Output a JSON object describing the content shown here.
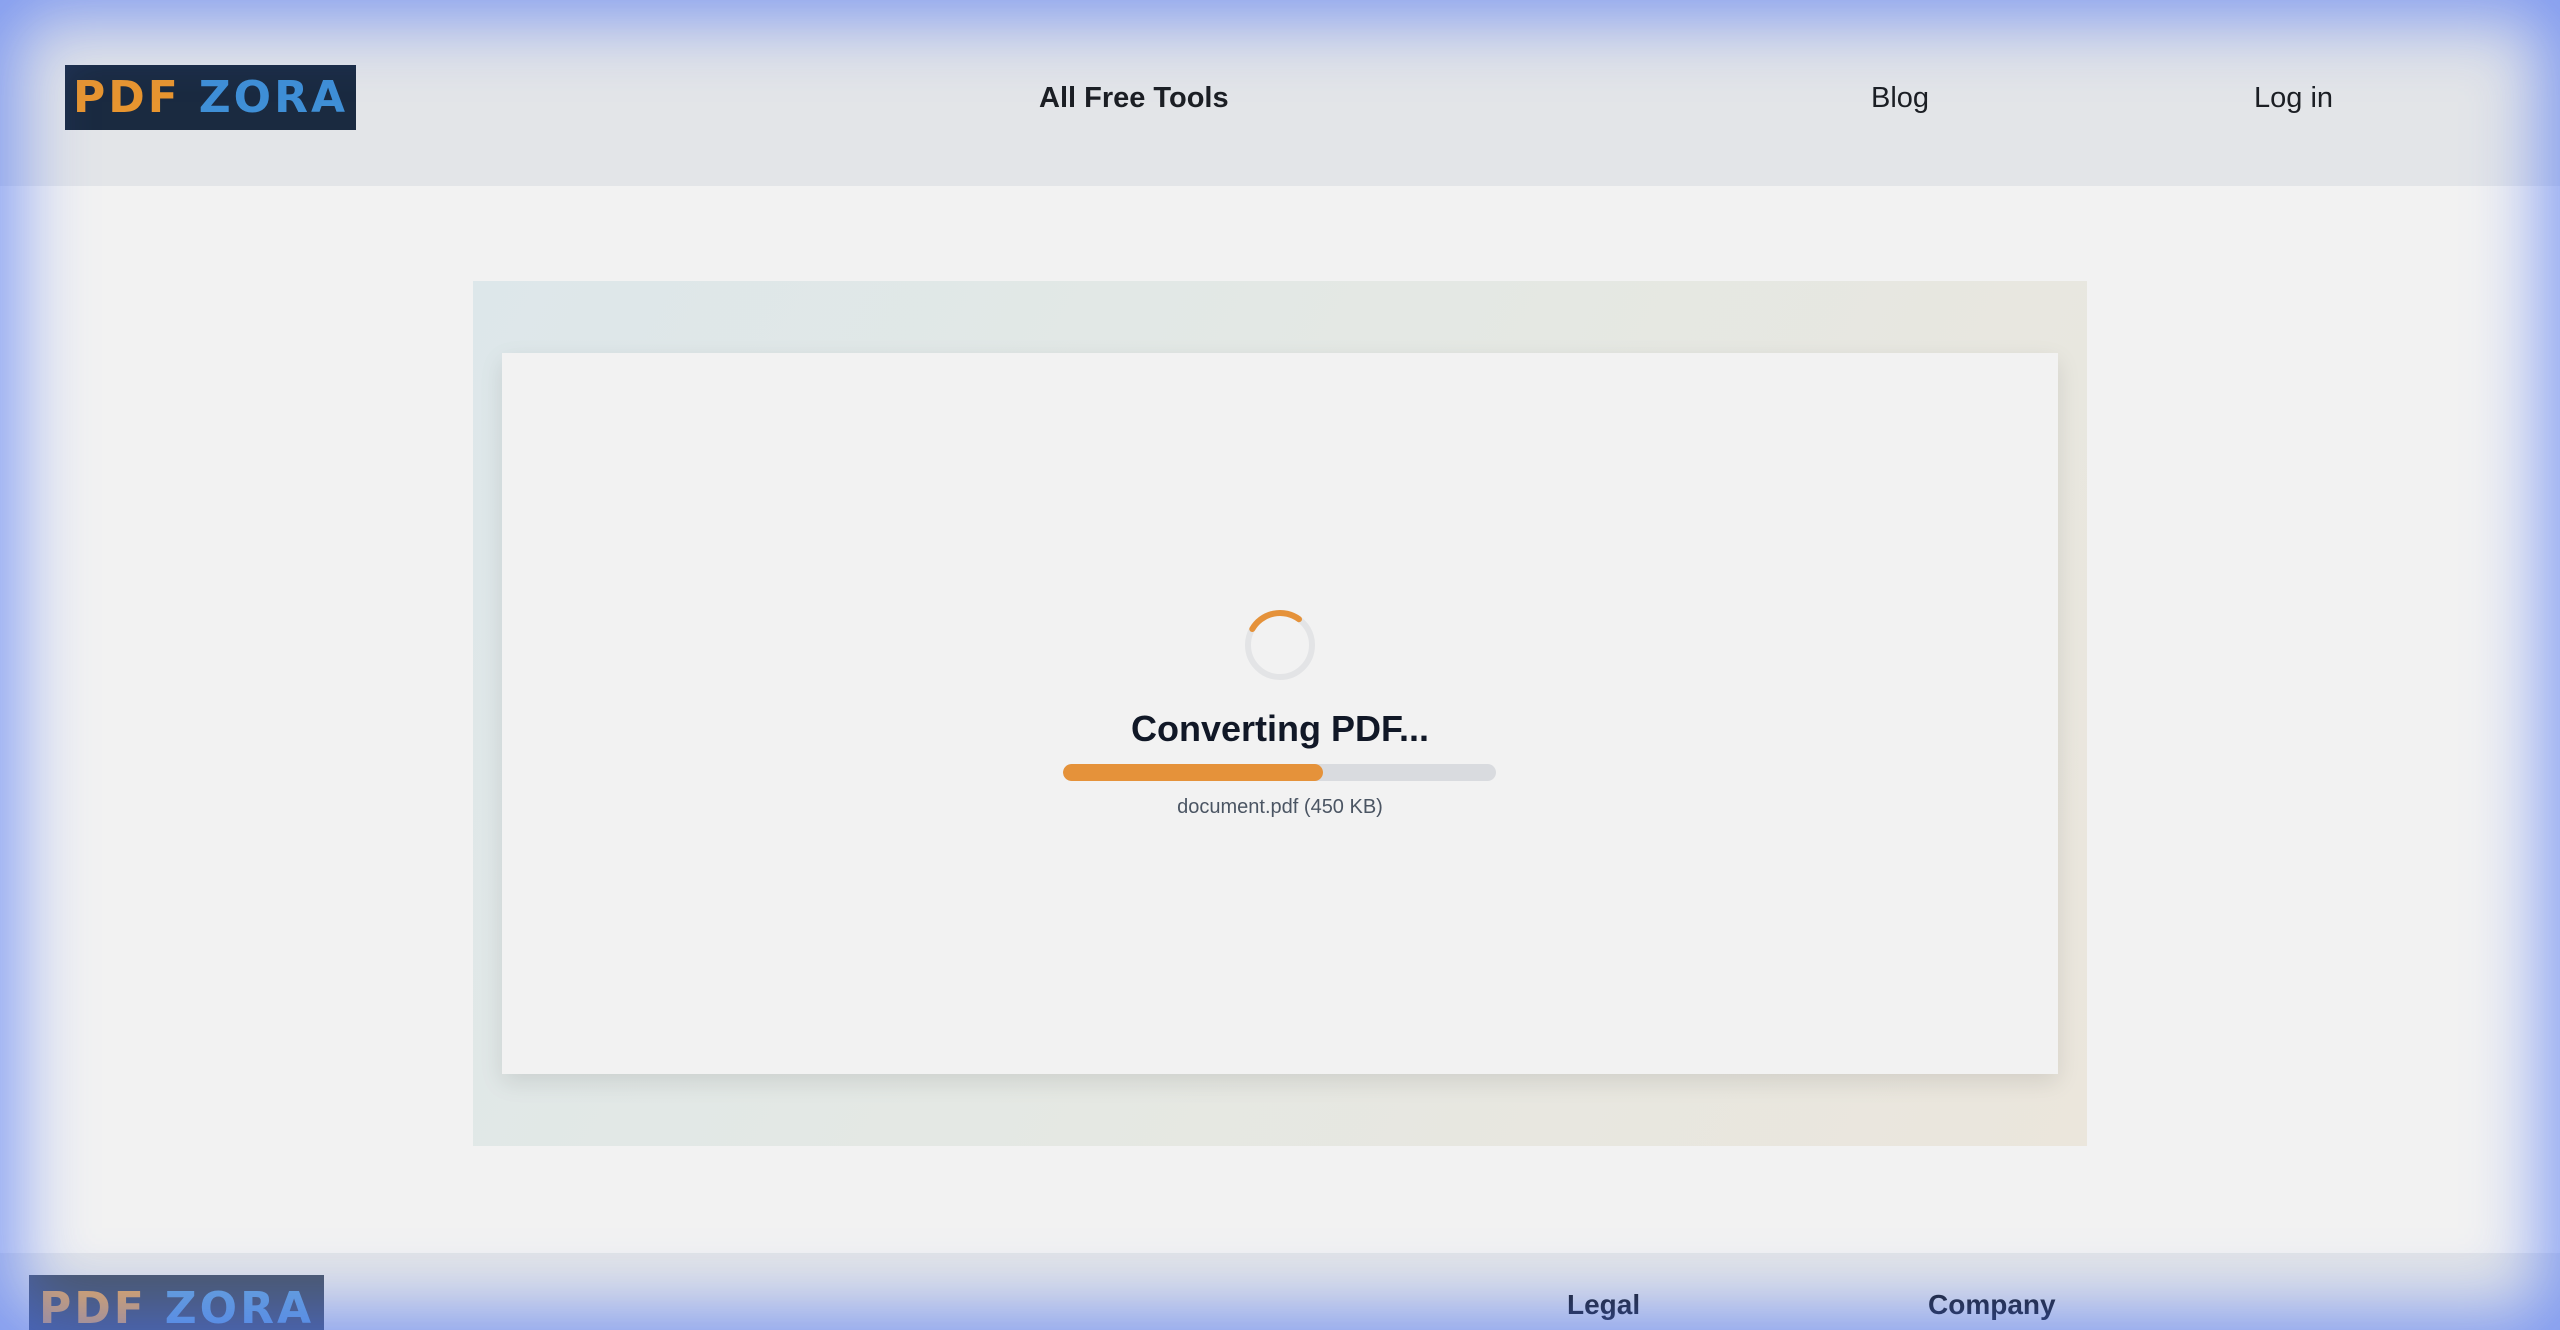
{
  "header": {
    "logo": {
      "part1": "PDF",
      "part2": "ZORA"
    },
    "nav": {
      "tools_label": "All Free Tools",
      "blog_label": "Blog",
      "login_label": "Log in"
    }
  },
  "conversion": {
    "title": "Converting PDF...",
    "progress_percent": 60,
    "file_info": "document.pdf (450 KB)"
  },
  "footer": {
    "logo": {
      "part1": "PDF",
      "part2": "ZORA"
    },
    "headings": {
      "legal": "Legal",
      "company": "Company"
    }
  },
  "colors": {
    "accent": "#e5923a",
    "logo_background": "#1a2a40",
    "logo_blue": "#3f8fd6",
    "logo_orange": "#e8952f",
    "vignette": "#466ef5"
  },
  "icons": {
    "spinner": "loading-spinner-icon"
  }
}
